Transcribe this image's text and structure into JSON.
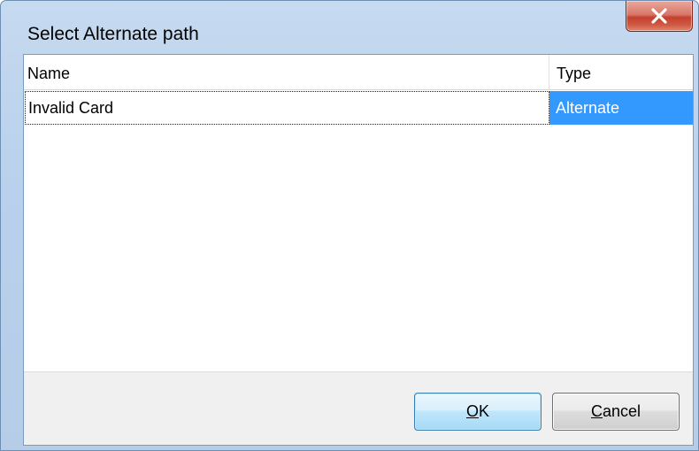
{
  "window": {
    "title": "Select Alternate path",
    "close_icon": "close-x-icon"
  },
  "list": {
    "columns": [
      "Name",
      "Type"
    ],
    "rows": [
      {
        "name": "Invalid Card",
        "type": "Alternate",
        "selected": true
      }
    ]
  },
  "buttons": {
    "ok_mnemonic": "O",
    "ok_rest": "K",
    "cancel_mnemonic": "C",
    "cancel_rest": "ancel"
  },
  "colors": {
    "selection": "#3399ff",
    "close_button": "#c4402f"
  }
}
